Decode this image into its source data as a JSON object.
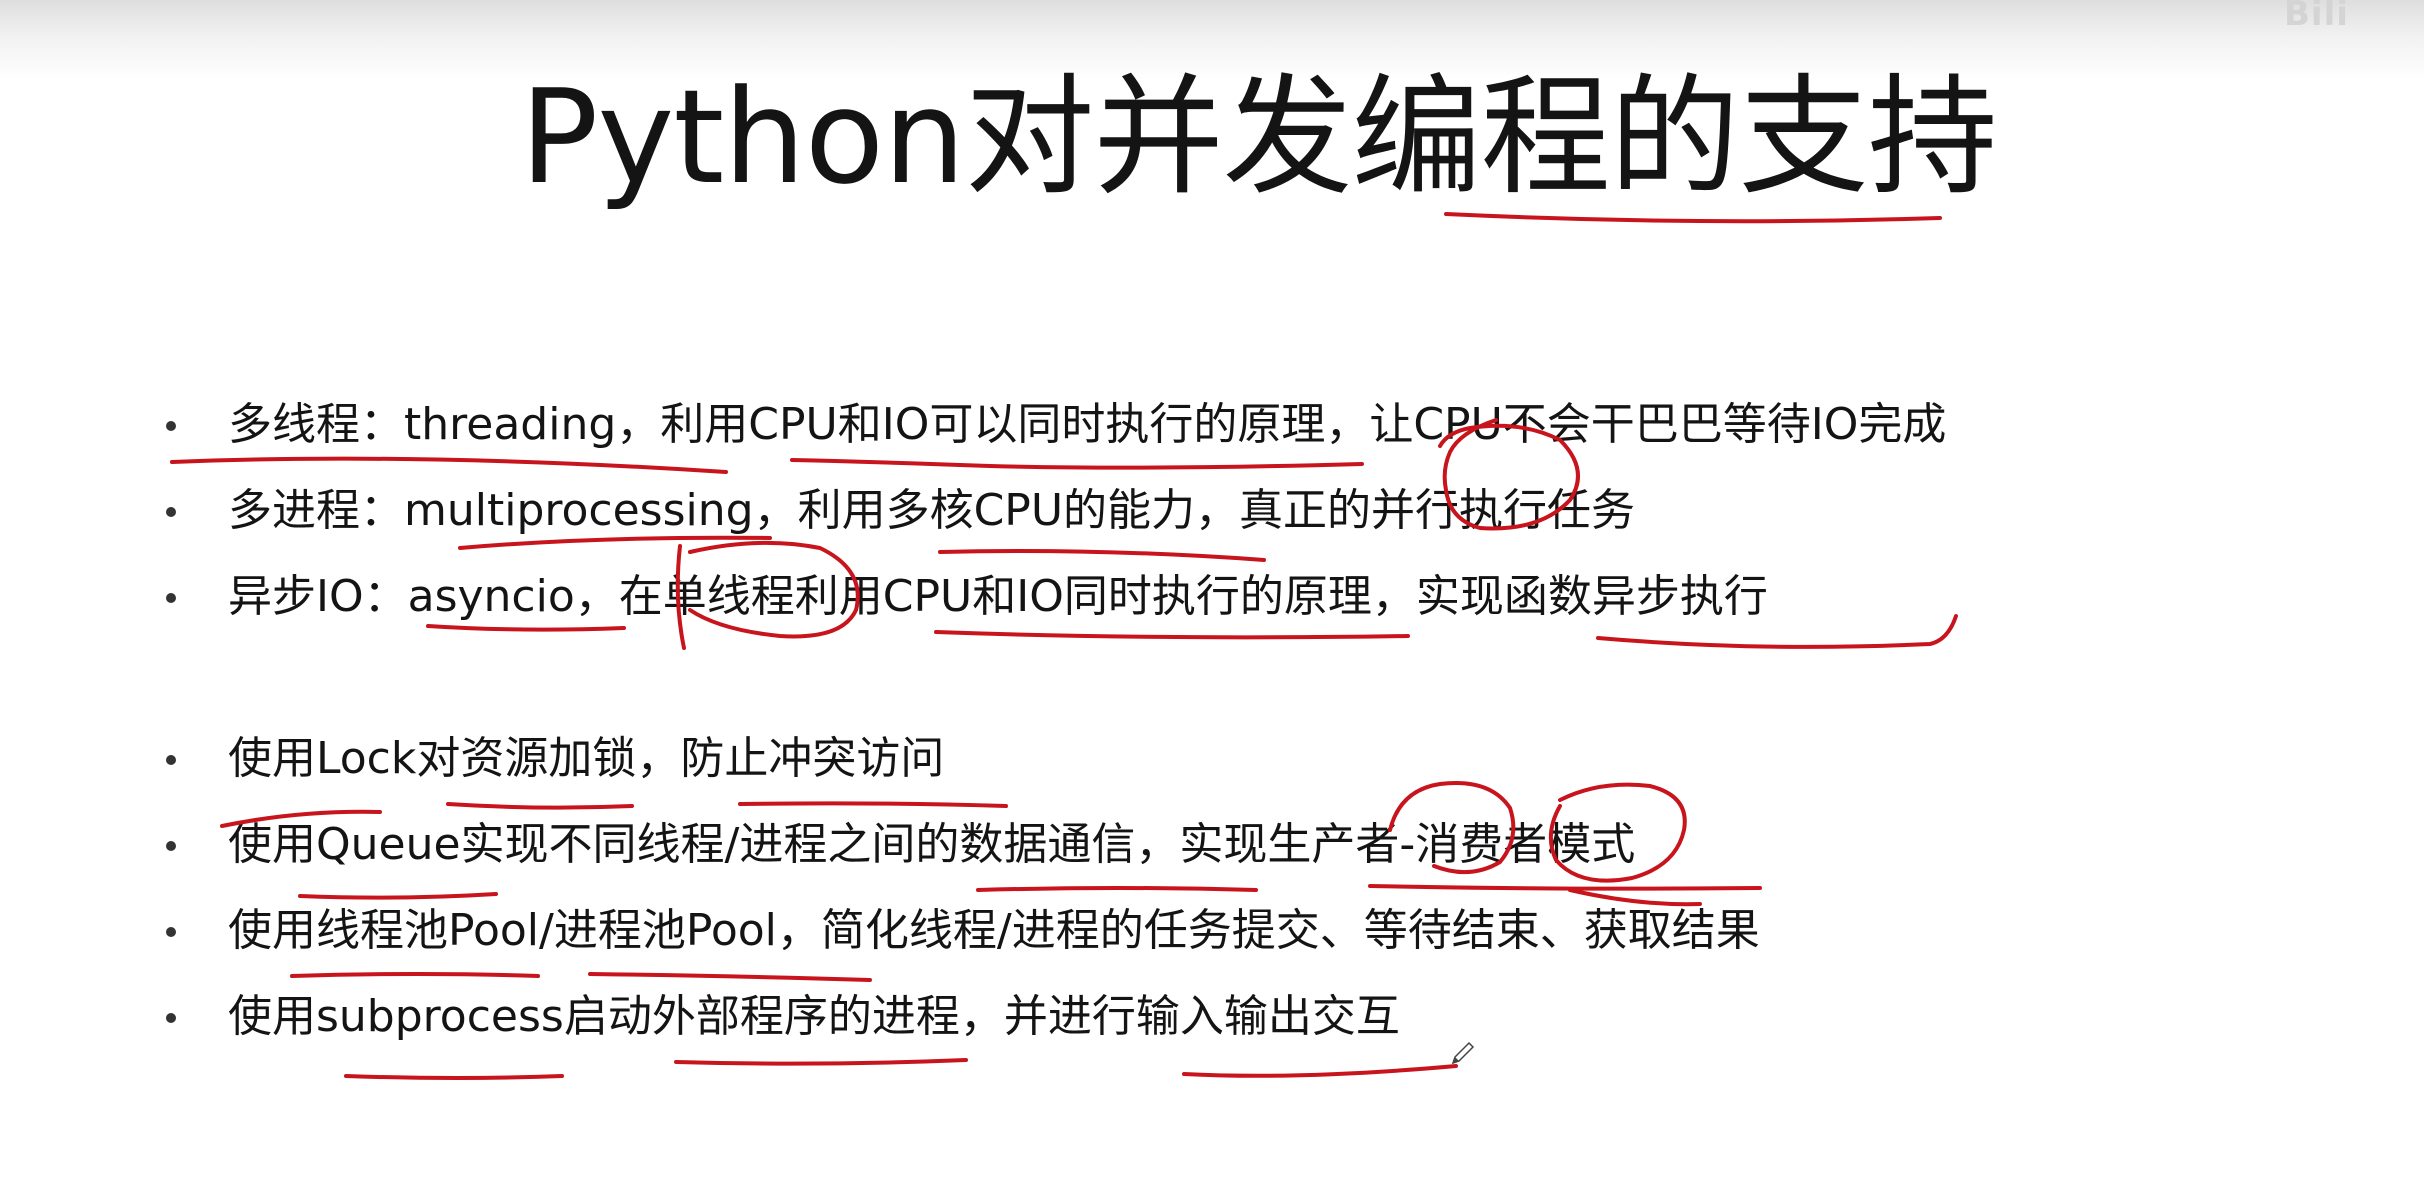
{
  "slide": {
    "title": "Python对并发编程的支持",
    "watermark": "Bili",
    "bullets_group1": [
      "多线程：threading，利用CPU和IO可以同时执行的原理，让CPU不会干巴巴等待IO完成",
      "多进程：multiprocessing，利用多核CPU的能力，真正的并行执行任务",
      "异步IO：asyncio，在单线程利用CPU和IO同时执行的原理，实现函数异步执行"
    ],
    "bullets_group2": [
      "使用Lock对资源加锁，防止冲突访问",
      "使用Queue实现不同线程/进程之间的数据通信，实现生产者-消费者模式",
      "使用线程池Pool/进程池Pool，简化线程/进程的任务提交、等待结束、获取结果",
      "使用subprocess启动外部程序的进程，并进行输入输出交互"
    ]
  },
  "colors": {
    "annotation_ink": "#c8141c",
    "text": "#141414",
    "background": "#ffffff"
  },
  "icons": [
    "bullet-dot",
    "cursor-pen-icon"
  ]
}
